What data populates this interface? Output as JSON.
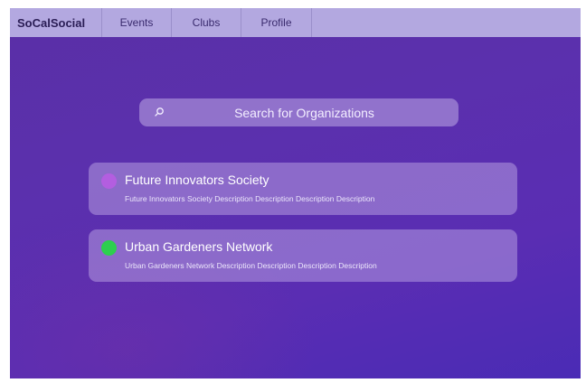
{
  "app": {
    "brand": "SoCalSocial"
  },
  "nav": {
    "items": [
      {
        "label": "Events"
      },
      {
        "label": "Clubs"
      },
      {
        "label": "Profile"
      }
    ]
  },
  "search": {
    "label": "Search for Organizations",
    "icon": "search-icon"
  },
  "organizations": [
    {
      "name": "Future Innovators Society",
      "description": "Future Innovators Society Description Description Description Description",
      "color": "#b35ee0"
    },
    {
      "name": "Urban Gardeners Network",
      "description": "Urban Gardeners Network Description Description Description Description",
      "color": "#2dcf4f"
    }
  ],
  "colors": {
    "navbar": "#b3a8e0",
    "background": "#5a2fa6",
    "accent_purple": "#b35ee0",
    "accent_green": "#2dcf4f"
  }
}
